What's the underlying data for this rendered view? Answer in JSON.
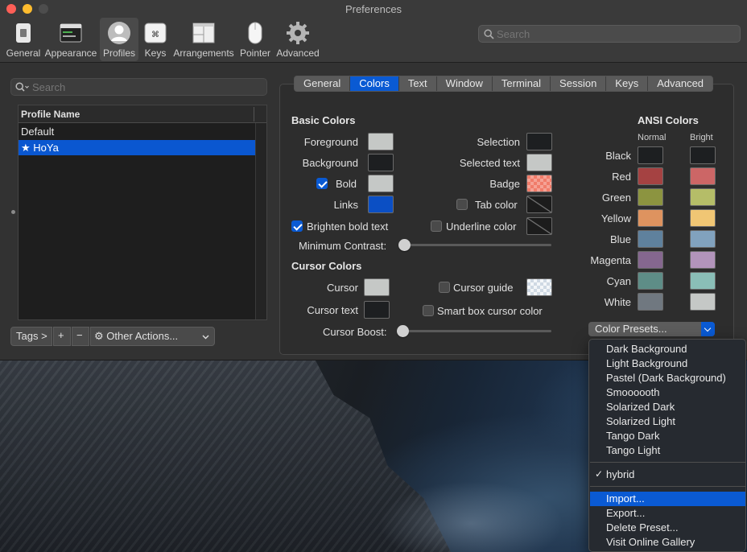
{
  "window": {
    "title": "Preferences"
  },
  "toolbar": {
    "items": [
      {
        "label": "General",
        "icon": "general-icon"
      },
      {
        "label": "Appearance",
        "icon": "appearance-icon"
      },
      {
        "label": "Profiles",
        "icon": "profiles-icon",
        "active": true
      },
      {
        "label": "Keys",
        "icon": "keys-icon"
      },
      {
        "label": "Arrangements",
        "icon": "arrangements-icon"
      },
      {
        "label": "Pointer",
        "icon": "pointer-icon"
      },
      {
        "label": "Advanced",
        "icon": "gear-icon"
      }
    ],
    "search_placeholder": "Search"
  },
  "profiles": {
    "search_placeholder": "Search",
    "column_header": "Profile Name",
    "rows": [
      "Default",
      "HoYa"
    ],
    "selected": "HoYa",
    "tags_label": "Tags >",
    "add_label": "+",
    "remove_label": "−",
    "other_actions_label": "Other Actions..."
  },
  "tabs": [
    "General",
    "Colors",
    "Text",
    "Window",
    "Terminal",
    "Session",
    "Keys",
    "Advanced"
  ],
  "active_tab": "Colors",
  "basic_colors": {
    "heading": "Basic Colors",
    "foreground": "Foreground",
    "background": "Background",
    "bold": "Bold",
    "links": "Links",
    "selection": "Selection",
    "selected_text": "Selected text",
    "badge": "Badge",
    "tab_color": "Tab color",
    "brighten_bold": "Brighten bold text",
    "underline_color": "Underline color",
    "minimum_contrast": "Minimum Contrast:",
    "minimum_contrast_value": 0,
    "colors": {
      "foreground": "#c5c8c6",
      "background": "#1d1f21",
      "bold": "#c5c8c6",
      "links": "#0b4fc4",
      "selection": "#1d1f21",
      "selected_text": "#c5c8c6"
    }
  },
  "cursor_colors": {
    "heading": "Cursor Colors",
    "cursor": "Cursor",
    "cursor_text": "Cursor text",
    "cursor_guide": "Cursor guide",
    "smart_box": "Smart box cursor color",
    "cursor_boost": "Cursor Boost:",
    "cursor_boost_value": 0,
    "colors": {
      "cursor": "#c5c8c6",
      "cursor_text": "#1d1f21"
    }
  },
  "ansi": {
    "heading": "ANSI Colors",
    "normal_label": "Normal",
    "bright_label": "Bright",
    "rows": [
      {
        "name": "Black",
        "normal": "#1d1f21",
        "bright": "#1d1f21"
      },
      {
        "name": "Red",
        "normal": "#a54242",
        "bright": "#cc6666"
      },
      {
        "name": "Green",
        "normal": "#8c9440",
        "bright": "#b5bd68"
      },
      {
        "name": "Yellow",
        "normal": "#de935f",
        "bright": "#f0c674"
      },
      {
        "name": "Blue",
        "normal": "#5f819d",
        "bright": "#81a2be"
      },
      {
        "name": "Magenta",
        "normal": "#85678f",
        "bright": "#b294bb"
      },
      {
        "name": "Cyan",
        "normal": "#5e8d87",
        "bright": "#8abeb7"
      },
      {
        "name": "White",
        "normal": "#707880",
        "bright": "#c5c8c6"
      }
    ]
  },
  "color_presets": {
    "button_label": "Color Presets...",
    "menu_items": [
      "Dark Background",
      "Light Background",
      "Pastel (Dark Background)",
      "Smoooooth",
      "Solarized Dark",
      "Solarized Light",
      "Tango Dark",
      "Tango Light"
    ],
    "checked_item": "hybrid",
    "check_mark": "✓",
    "actions": [
      "Import...",
      "Export...",
      "Delete Preset...",
      "Visit Online Gallery"
    ],
    "highlighted_action": "Import..."
  }
}
